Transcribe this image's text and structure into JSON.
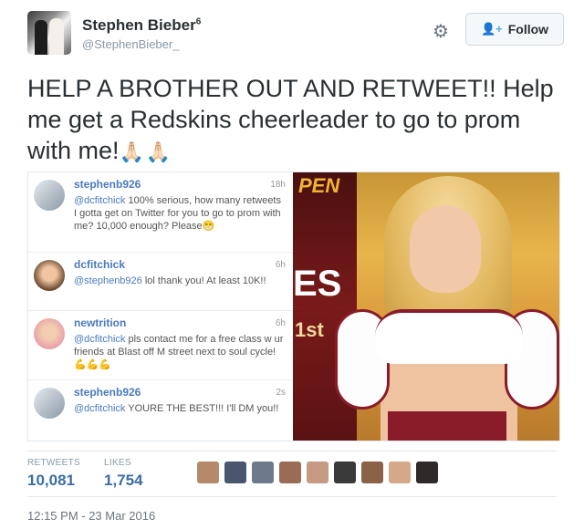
{
  "user": {
    "name": "Stephen Bieber",
    "name_superscript": "6",
    "handle": "@StephenBieber_",
    "follow_label": "Follow"
  },
  "tweet": {
    "text": "HELP A BROTHER OUT AND RETWEET!! Help me get a Redskins cheerleader to go to prom with me!",
    "emoji": "🙏🏻🙏🏻"
  },
  "media": {
    "feed": [
      {
        "user": "stephenb926",
        "time": "18h",
        "mention": "@dcfitchick",
        "text": " 100% serious, how many retweets I gotta get on Twitter for you to go to prom with me? 10,000 enough? Please😁"
      },
      {
        "user": "dcfitchick",
        "time": "6h",
        "mention": "@stephenb926",
        "text": " lol thank you! At least 10K!!"
      },
      {
        "user": "newtrition",
        "time": "6h",
        "mention": "@dcfitchick",
        "text": " pls contact me for a free class w ur friends at Blast off M street next to soul cycle! 💪💪💪"
      },
      {
        "user": "stephenb926",
        "time": "2s",
        "mention": "@dcfitchick",
        "text": " YOURE THE BEST!!! I'll DM you!!"
      }
    ],
    "banner_text": {
      "top": "PEN",
      "middle": "ES",
      "bottom": "1st"
    }
  },
  "stats": {
    "retweets_label": "RETWEETS",
    "retweets_value": "10,081",
    "likes_label": "LIKES",
    "likes_value": "1,754"
  },
  "likers_colors": [
    "#b58a6a",
    "#4a5670",
    "#6c7a8c",
    "#9a6b55",
    "#c79a84",
    "#3a3a3a",
    "#8a6248",
    "#d6a88a",
    "#2e2a2a"
  ],
  "timestamp": "12:15 PM - 23 Mar 2016",
  "colors": {
    "link": "#4a7bbd",
    "stat_value": "#3b6ea5",
    "accent": "#55acee",
    "burgundy": "#8a1c2a",
    "gold": "#f0b531"
  }
}
